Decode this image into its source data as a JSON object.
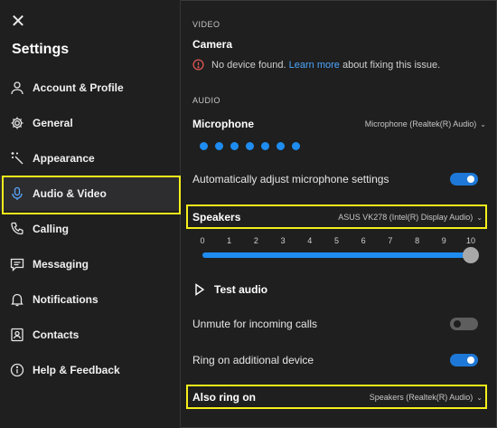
{
  "app": {
    "title": "Settings"
  },
  "icons": {
    "close": "close-icon",
    "error": "error-circle-icon",
    "play": "play-icon"
  },
  "sidebar": {
    "items": [
      {
        "label": "Account & Profile",
        "icon": "person-icon"
      },
      {
        "label": "General",
        "icon": "gear-icon"
      },
      {
        "label": "Appearance",
        "icon": "magic-wand-icon"
      },
      {
        "label": "Audio & Video",
        "icon": "microphone-icon",
        "active": true
      },
      {
        "label": "Calling",
        "icon": "phone-icon"
      },
      {
        "label": "Messaging",
        "icon": "chat-icon"
      },
      {
        "label": "Notifications",
        "icon": "bell-icon"
      },
      {
        "label": "Contacts",
        "icon": "contacts-icon"
      },
      {
        "label": "Help & Feedback",
        "icon": "info-icon"
      }
    ]
  },
  "video": {
    "section_label": "VIDEO",
    "camera_label": "Camera",
    "error_text": "No device found.",
    "learn_more": "Learn more",
    "error_suffix": "about fixing this issue."
  },
  "audio": {
    "section_label": "AUDIO",
    "microphone_label": "Microphone",
    "microphone_device": "Microphone (Realtek(R) Audio)",
    "mic_level_dots": 7,
    "auto_adjust_label": "Automatically adjust microphone settings",
    "auto_adjust_on": true,
    "speakers_label": "Speakers",
    "speakers_device": "ASUS VK278 (Intel(R) Display Audio)",
    "volume_ticks": [
      "0",
      "1",
      "2",
      "3",
      "4",
      "5",
      "6",
      "7",
      "8",
      "9",
      "10"
    ],
    "volume_value": 10,
    "test_audio_label": "Test audio",
    "unmute_label": "Unmute for incoming calls",
    "unmute_on": false,
    "ring_additional_label": "Ring on additional device",
    "ring_additional_on": true,
    "also_ring_label": "Also ring on",
    "also_ring_device": "Speakers (Realtek(R) Audio)"
  },
  "colors": {
    "accent": "#1e8cf0",
    "highlight": "#f5ef1b",
    "error": "#e05656",
    "link": "#4ba6ff"
  }
}
